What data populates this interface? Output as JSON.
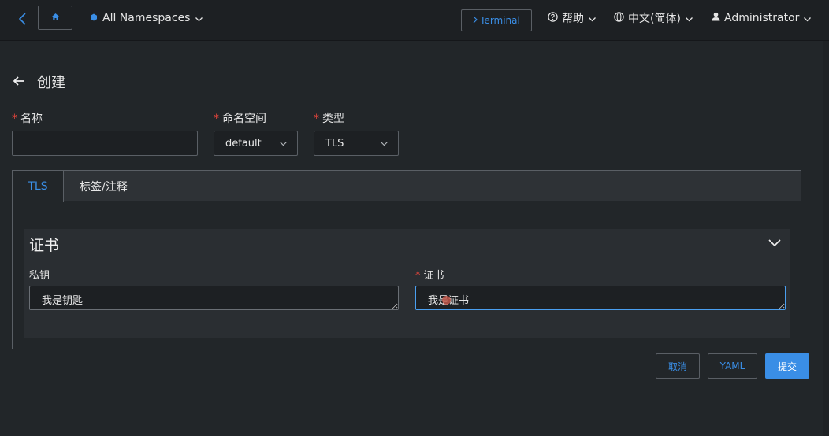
{
  "topbar": {
    "namespace_label": "All Namespaces",
    "terminal_label": "Terminal",
    "help_label": "帮助",
    "language_label": "中文(简体)",
    "user_label": "Administrator"
  },
  "page": {
    "title": "创建"
  },
  "form": {
    "name": {
      "label": "名称",
      "value": ""
    },
    "namespace": {
      "label": "命名空间",
      "value": "default"
    },
    "type": {
      "label": "类型",
      "value": "TLS"
    }
  },
  "tabs": [
    {
      "label": "TLS",
      "active": true
    },
    {
      "label": "标签/注释",
      "active": false
    }
  ],
  "cert_section": {
    "title": "证书",
    "private_key": {
      "label": "私钥",
      "value": "我是钥匙"
    },
    "certificate": {
      "label": "证书",
      "value": "我是证书"
    }
  },
  "actions": {
    "cancel": "取消",
    "yaml": "YAML",
    "submit": "提交"
  },
  "colors": {
    "accent": "#3a8ee6",
    "required": "#e6453c",
    "background": "#222629"
  }
}
